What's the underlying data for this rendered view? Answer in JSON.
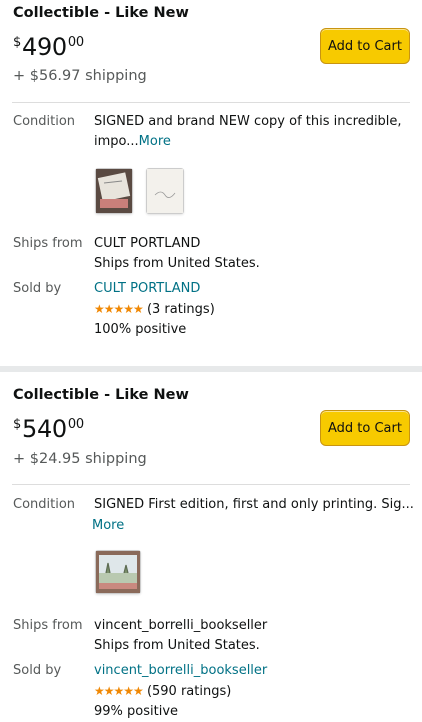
{
  "offers": [
    {
      "condition_title": "Collectible - Like New",
      "price_symbol": "$",
      "price_whole": "490",
      "price_fraction": "00",
      "shipping": "+ $56.97 shipping",
      "add_to_cart": "Add to Cart",
      "condition_label": "Condition",
      "condition_text_line1": "SIGNED and brand NEW copy of this incredible,",
      "condition_text_line2": "impo...",
      "more_label": "More",
      "ships_from_label": "Ships from",
      "ships_from_name": "CULT PORTLAND",
      "ships_from_country": "Ships from United States.",
      "sold_by_label": "Sold by",
      "seller": "CULT PORTLAND",
      "stars": "★★★★★",
      "ratings": "(3 ratings)",
      "positive": "100% positive"
    },
    {
      "condition_title": "Collectible - Like New",
      "price_symbol": "$",
      "price_whole": "540",
      "price_fraction": "00",
      "shipping": "+ $24.95 shipping",
      "add_to_cart": "Add to Cart",
      "condition_label": "Condition",
      "condition_text_line1": "SIGNED First edition, first and only printing. Sig...",
      "more_label": "More",
      "ships_from_label": "Ships from",
      "ships_from_name": "vincent_borrelli_bookseller",
      "ships_from_country": "Ships from United States.",
      "sold_by_label": "Sold by",
      "seller": "vincent_borrelli_bookseller",
      "stars": "★★★★★",
      "ratings": "(590 ratings)",
      "positive": "99% positive"
    }
  ],
  "colors": {
    "button": "#f7ca00",
    "link": "#007185",
    "stars": "#f08804",
    "muted_text": "#565959"
  }
}
